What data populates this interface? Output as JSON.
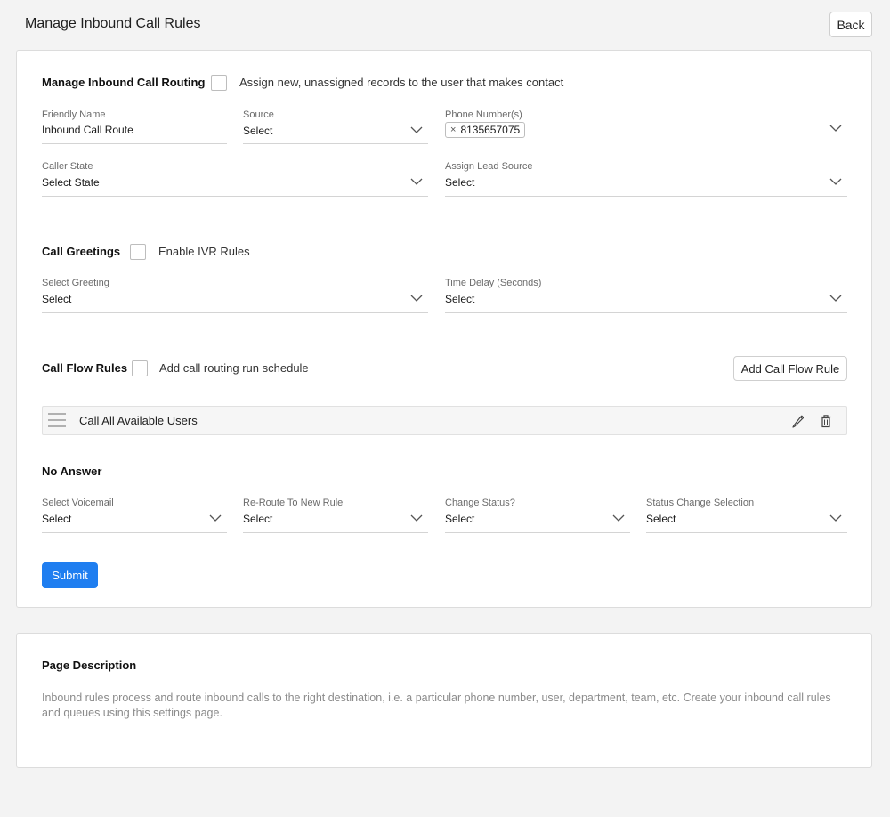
{
  "header": {
    "title": "Manage Inbound Call Rules",
    "back_label": "Back"
  },
  "routing": {
    "title": "Manage Inbound Call Routing",
    "assign_label": "Assign new, unassigned records to the user that makes contact",
    "friendly_name": {
      "label": "Friendly Name",
      "value": "Inbound Call Route"
    },
    "source": {
      "label": "Source",
      "value": "Select"
    },
    "phone_numbers": {
      "label": "Phone Number(s)",
      "chips": [
        "8135657075"
      ]
    },
    "caller_state": {
      "label": "Caller State",
      "value": "Select State"
    },
    "lead_source": {
      "label": "Assign Lead Source",
      "value": "Select"
    }
  },
  "greetings": {
    "title": "Call Greetings",
    "ivr_label": "Enable IVR Rules",
    "select_greeting": {
      "label": "Select Greeting",
      "value": "Select"
    },
    "time_delay": {
      "label": "Time Delay (Seconds)",
      "value": "Select"
    }
  },
  "flow": {
    "title": "Call Flow Rules",
    "schedule_label": "Add call routing run schedule",
    "add_label": "Add Call Flow Rule",
    "rules": [
      "Call All Available Users"
    ]
  },
  "no_answer": {
    "title": "No Answer",
    "voicemail": {
      "label": "Select Voicemail",
      "value": "Select"
    },
    "reroute": {
      "label": "Re-Route To New Rule",
      "value": "Select"
    },
    "change_status": {
      "label": "Change Status?",
      "value": "Select"
    },
    "status_selection": {
      "label": "Status Change Selection",
      "value": "Select"
    }
  },
  "submit_label": "Submit",
  "description": {
    "title": "Page Description",
    "text": "Inbound rules process and route inbound calls to the right destination, i.e. a particular phone number, user, department, team, etc. Create your inbound call rules and queues using this settings page."
  },
  "colors": {
    "primary": "#1f7ef0",
    "background": "#f3f3f3"
  },
  "icons": [
    "chevron-down-icon",
    "close-icon",
    "drag-handle-icon",
    "pencil-icon",
    "trash-icon"
  ]
}
